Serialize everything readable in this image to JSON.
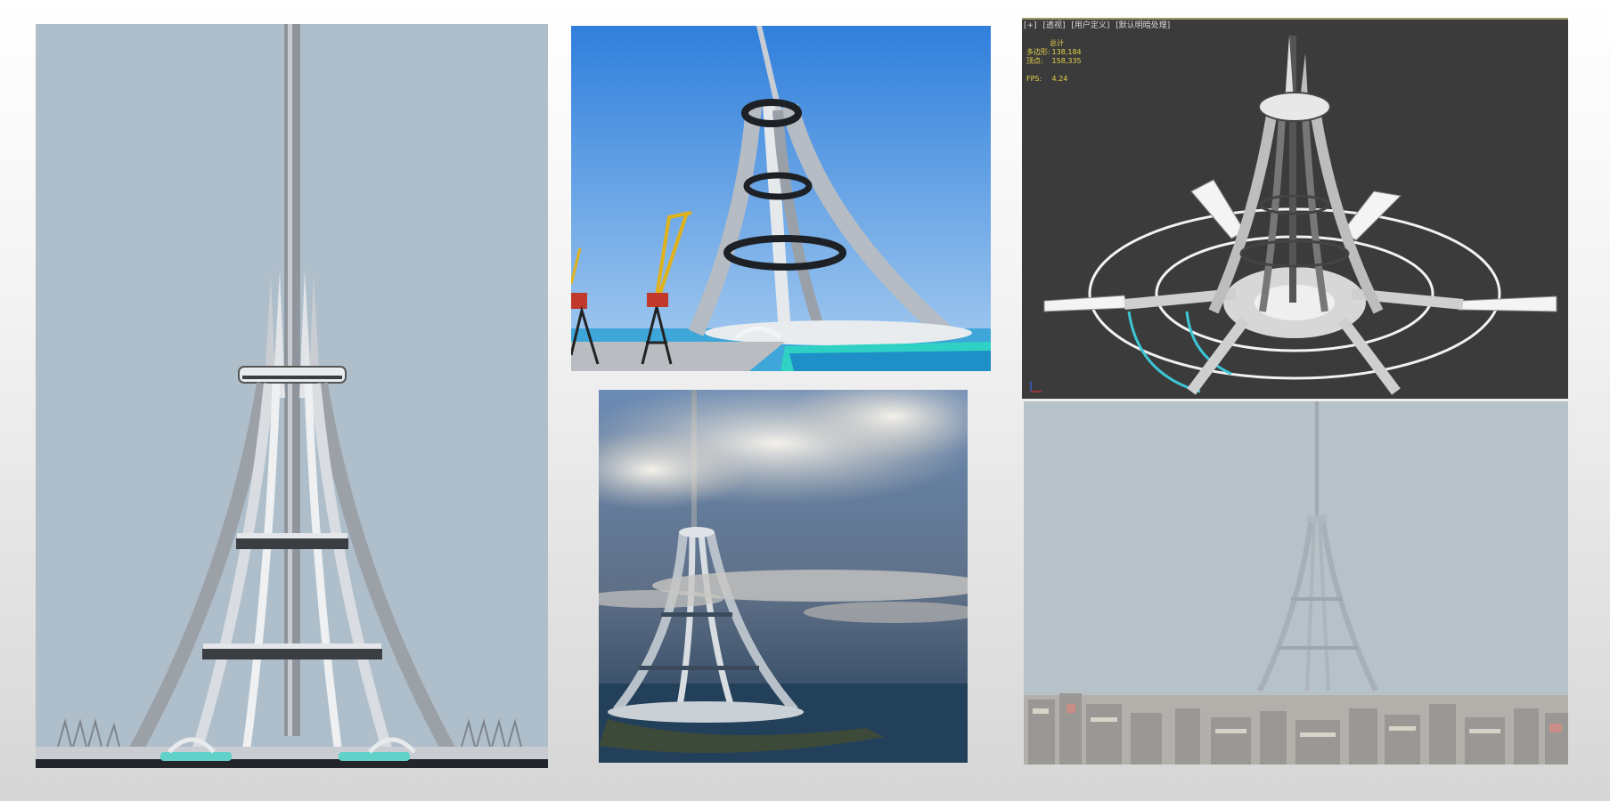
{
  "panels": [
    {
      "name": "Front elevation render"
    },
    {
      "name": "Harbor render with cranes"
    },
    {
      "name": "3D viewport wireframe"
    },
    {
      "name": "Tower above clouds"
    },
    {
      "name": "Tower over city in haze"
    }
  ],
  "viewport": {
    "menu": [
      "[+]",
      "[透视]",
      "[用户定义]",
      "[默认明暗处理]"
    ],
    "stats_header": "总计",
    "stats": [
      {
        "label": "多边形:",
        "value": "138,184"
      },
      {
        "label": "顶点:",
        "value": "158,335"
      }
    ],
    "fps_label": "FPS:",
    "fps_value": "4.24"
  },
  "colors": {
    "page_background": "#e9e9e9",
    "sky_front": "#aebfcb",
    "sky_blue": "#4f93da",
    "viewport_bg": "#3b3b3b",
    "stats_text": "#e6d24a",
    "selection_cyan": "#3cc6d6",
    "crane_yellow": "#e0b21c"
  }
}
